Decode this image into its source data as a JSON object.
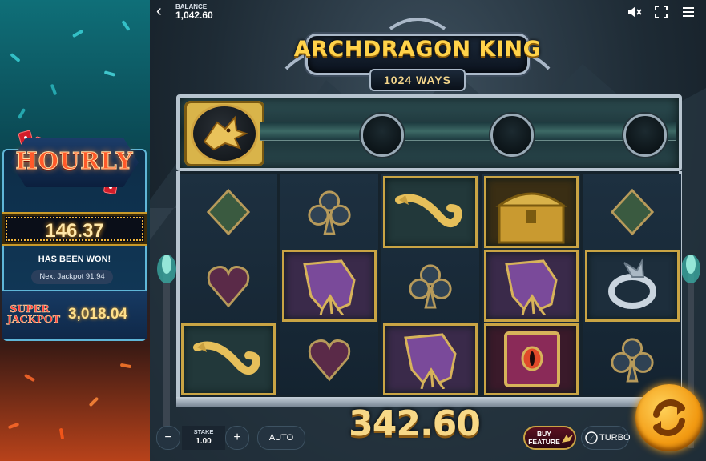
{
  "jackpot_panel": {
    "hourly_title": "HOURLY",
    "hourly_amount": "146.37",
    "won_text": "HAS BEEN WON!",
    "next_jackpot": "Next Jackpot 91.94",
    "super_label_line1": "SUPER",
    "super_label_line2": "JACKPOT",
    "super_amount": "3,018.04"
  },
  "top_bar": {
    "back_icon": "chevron-left-icon",
    "balance_label": "BALANCE",
    "balance_value": "1,042.60",
    "icons": [
      "speaker-muted-icon",
      "fullscreen-icon",
      "menu-icon"
    ]
  },
  "logo": {
    "title": "ARCHDRAGON KING",
    "ways": "1024 WAYS"
  },
  "reels": [
    [
      "green-diamond-suit",
      "purple-heart-suit",
      "golden-dragon-horn"
    ],
    [
      "blue-club-suit",
      "purple-dragon-claw",
      "purple-heart-suit"
    ],
    [
      "golden-dragon-horn",
      "blue-club-suit",
      "purple-dragon-claw"
    ],
    [
      "golden-treasure-chest",
      "purple-dragon-claw",
      "purple-spell-book"
    ],
    [
      "green-diamond-suit",
      "silver-dragon-ring",
      "blue-club-suit"
    ]
  ],
  "controls": {
    "minus": "−",
    "stake_label": "STAKE",
    "stake_value": "1.00",
    "plus": "+",
    "auto": "AUTO",
    "win_amount": "342.60",
    "buy_feature": "BUY FEATURE",
    "turbo": "TURBO"
  },
  "colors": {
    "gold": "#f7d887",
    "hourly_red": "#ff5a2a",
    "panel_blue": "#0d2d48",
    "spin_orange": "#f29a12"
  }
}
